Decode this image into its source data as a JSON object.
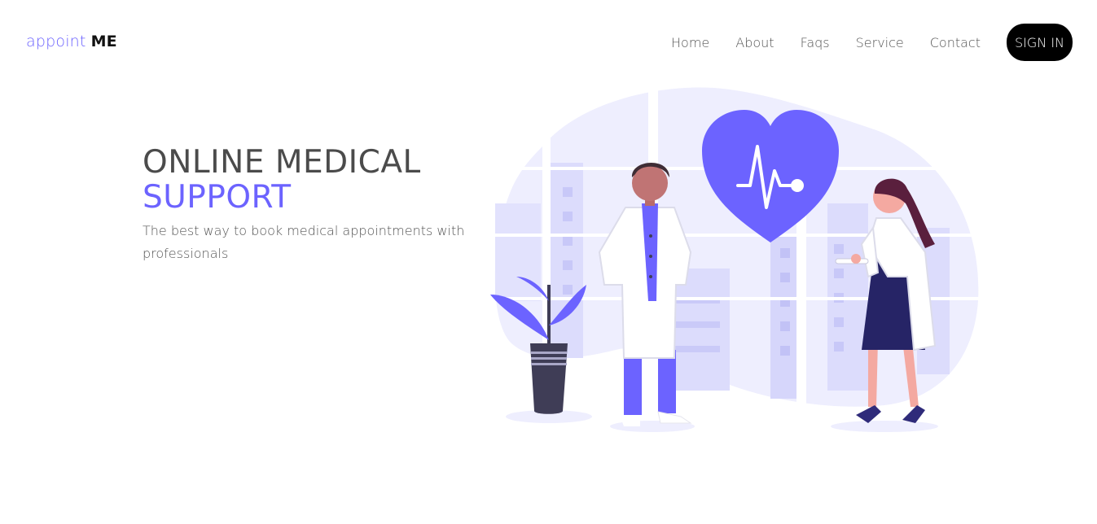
{
  "brand": {
    "part1": "appoint",
    "part2": "ME"
  },
  "nav": {
    "links": [
      "Home",
      "About",
      "Faqs",
      "Service",
      "Contact"
    ],
    "signin_label": "SIGN IN"
  },
  "hero": {
    "title_line1": "ONLINE MEDICAL",
    "title_line2": "SUPPORT",
    "subtitle": "The best way to book medical appointments with professionals"
  },
  "colors": {
    "accent": "#6c63ff",
    "dark": "#000000",
    "text": "#4b4b4b",
    "blob": "#eeeefe"
  },
  "illustration": {
    "icons": [
      "heart-pulse-icon",
      "male-doctor",
      "female-doctor",
      "potted-plant",
      "city-window-background"
    ]
  }
}
